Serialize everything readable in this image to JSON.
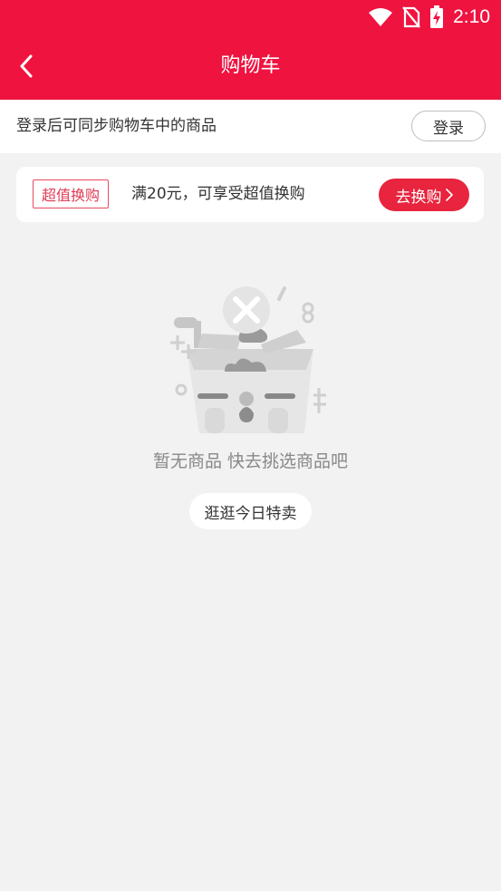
{
  "status_bar": {
    "time": "2:10"
  },
  "header": {
    "title": "购物车"
  },
  "login_bar": {
    "tip": "登录后可同步购物车中的商品",
    "button": "登录"
  },
  "promo": {
    "tag": "超值换购",
    "description": "满20元，可享受超值换购",
    "button": "去换购"
  },
  "empty_state": {
    "message": "暂无商品 快去挑选商品吧",
    "button": "逛逛今日特卖"
  },
  "colors": {
    "brand": "#ef1340",
    "promo_button": "#e8243e",
    "background": "#f2f2f2"
  }
}
